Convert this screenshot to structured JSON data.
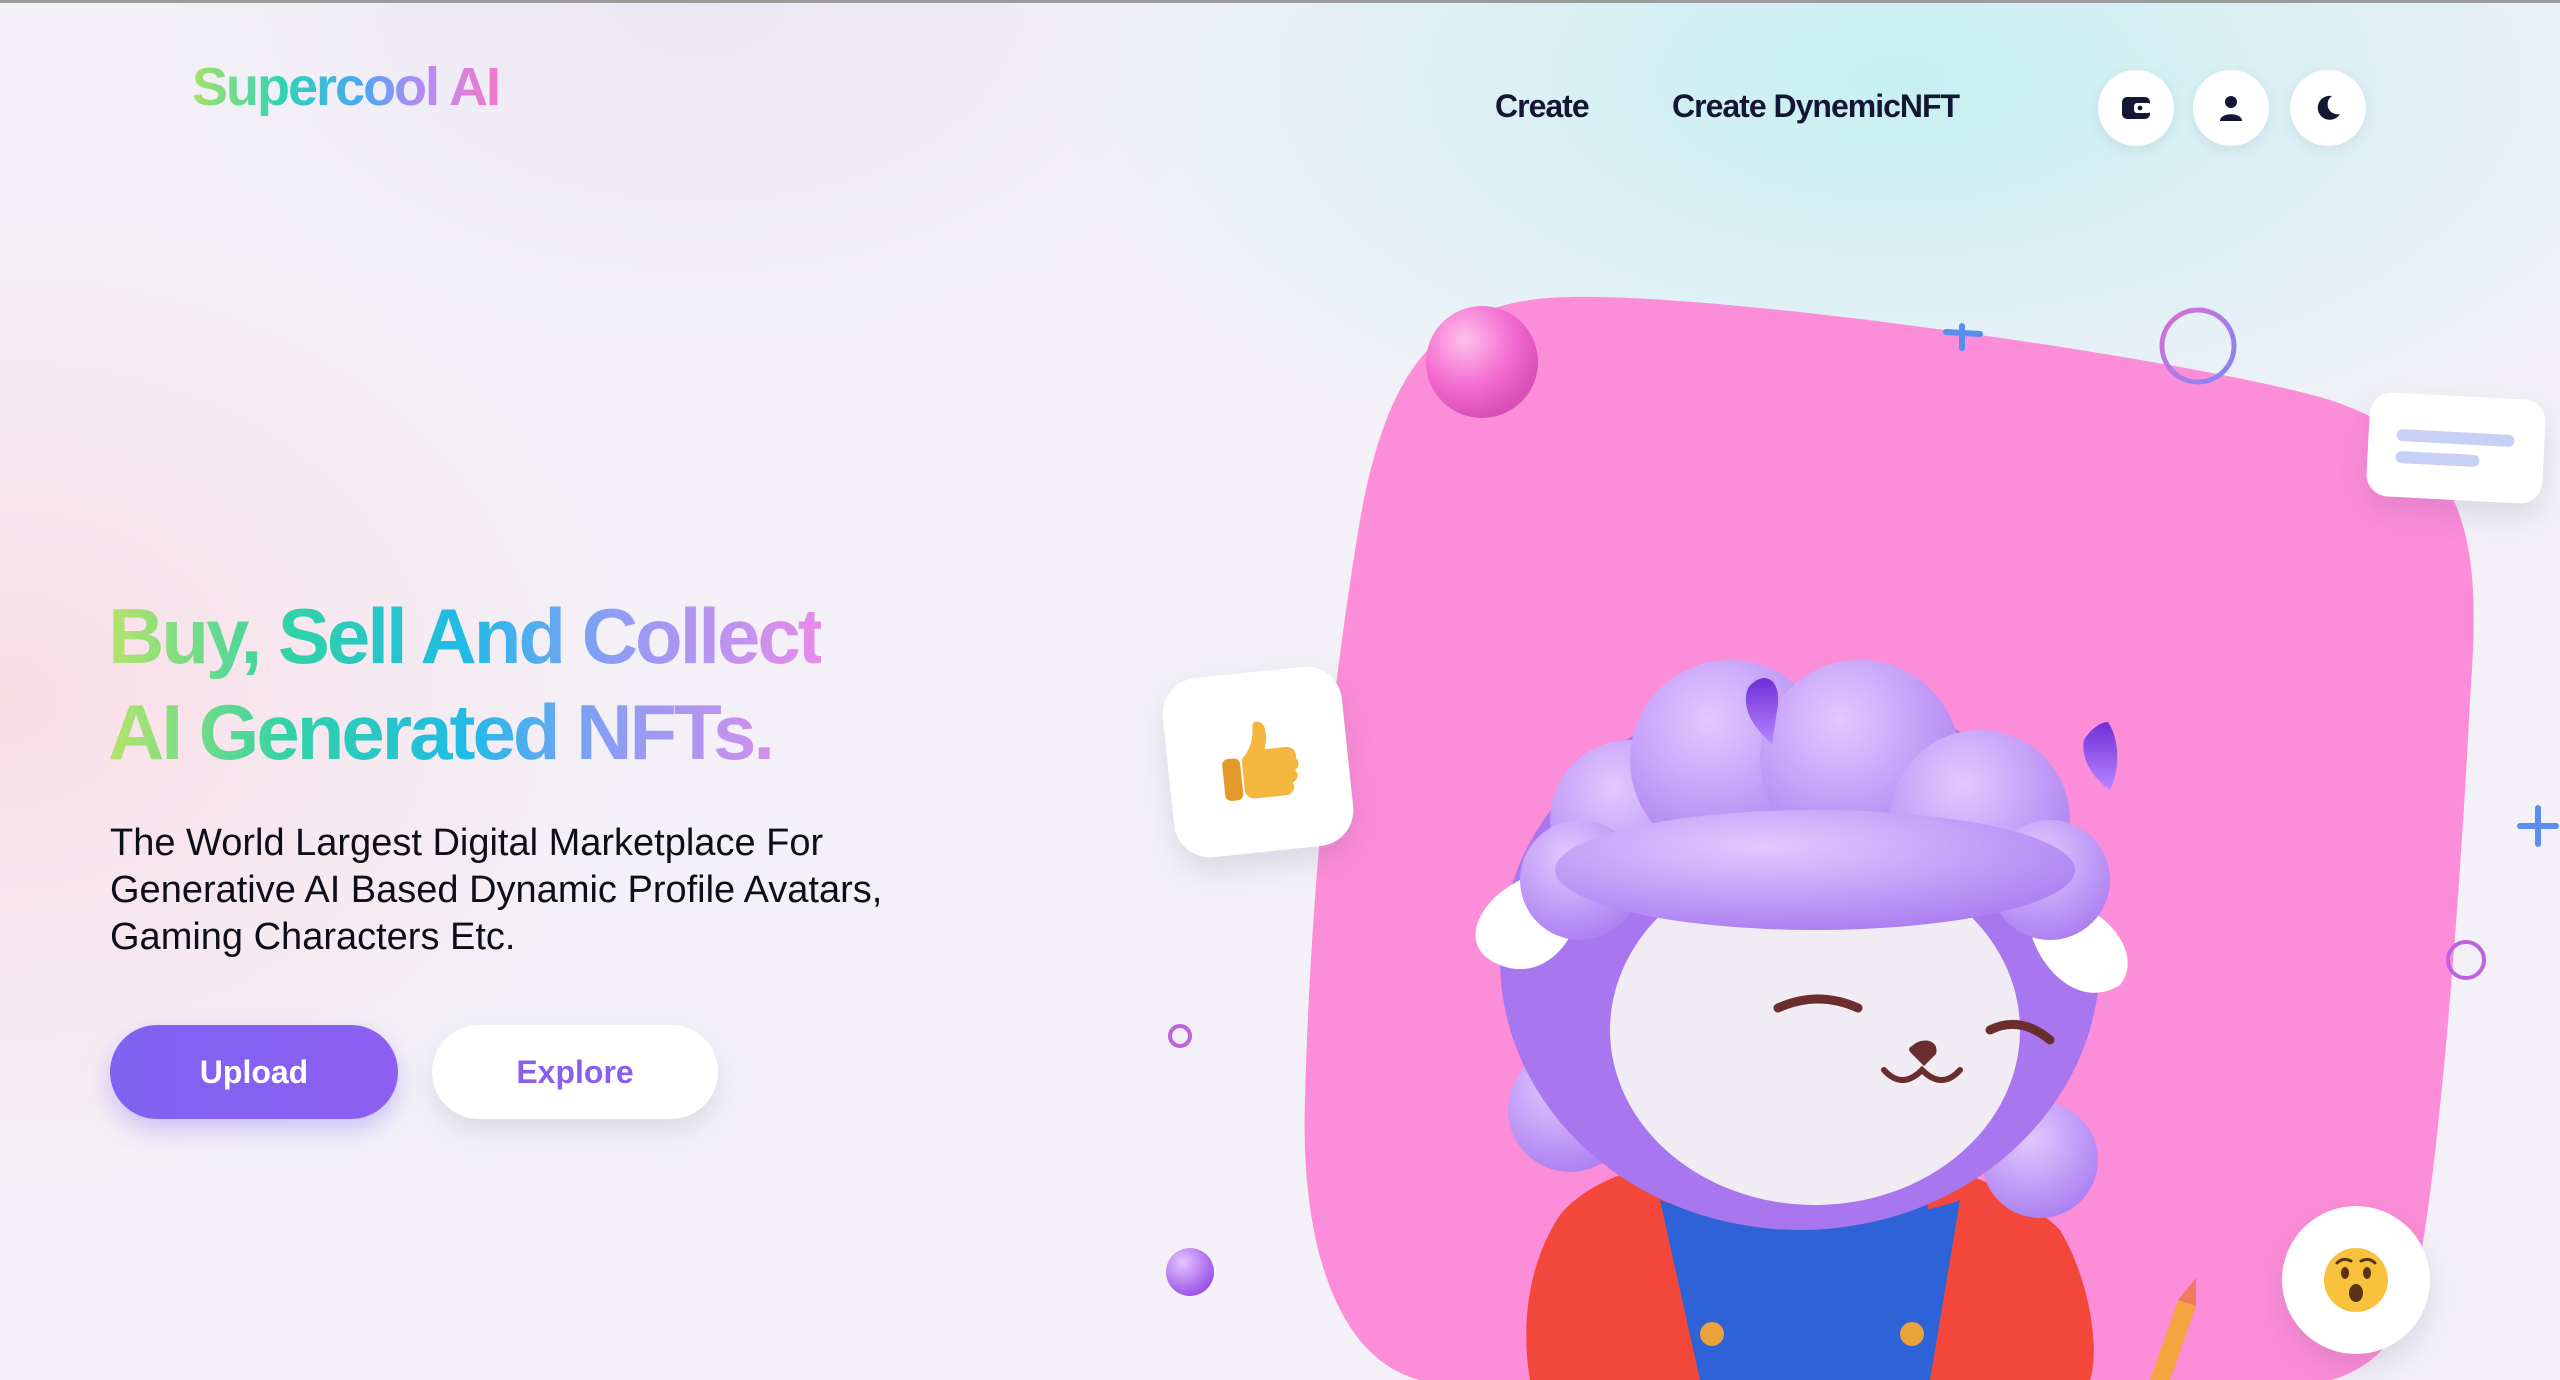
{
  "brand": {
    "name": "Supercool AI"
  },
  "nav": {
    "links": [
      "Create",
      "Create DynemicNFT"
    ]
  },
  "header_icons": [
    "wallet-icon",
    "user-icon",
    "moon-icon"
  ],
  "hero": {
    "title_line1": "Buy, Sell And Collect",
    "title_line2": "AI Generated NFTs.",
    "subtitle": "The World Largest Digital Marketplace For Generative AI Based Dynamic Profile Avatars, Gaming Characters Etc.",
    "upload_label": "Upload",
    "explore_label": "Explore"
  },
  "illustration": {
    "icons": [
      "thumbs-up-icon",
      "surprised-face-icon",
      "chat-bubble-icon"
    ]
  },
  "colors": {
    "primary": "#7d63f1",
    "accent_pink": "#fb8fd9",
    "text_dark": "#141634"
  }
}
